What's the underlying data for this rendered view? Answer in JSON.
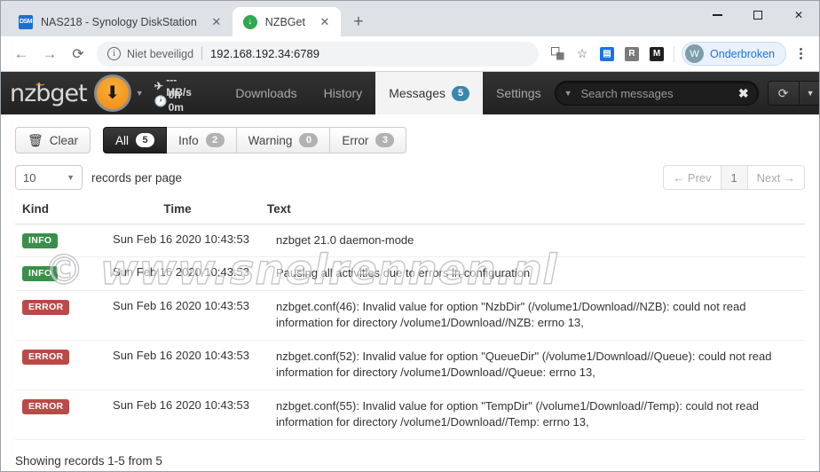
{
  "browser": {
    "tabs": [
      {
        "title": "NAS218 - Synology DiskStation",
        "favicon": "dsm-icon",
        "favicon_text": "DSM",
        "active": false
      },
      {
        "title": "NZBGet",
        "favicon": "nzbget-download-icon",
        "favicon_text": "↓",
        "active": true
      }
    ],
    "new_tab_label": "+",
    "close_label": "✕",
    "window_controls": {
      "minimize": "—",
      "maximize": "□",
      "close": "✕"
    },
    "nav": {
      "back": "←",
      "forward": "→",
      "reload": "⟳"
    },
    "omnibox": {
      "security_label": "Niet beveiligd",
      "info_glyph": "i",
      "url": "192.168.192.34:6789"
    },
    "toolbar_icons": [
      {
        "name": "translate-icon",
        "glyph": "⧉"
      },
      {
        "name": "bookmark-star-icon",
        "glyph": "☆"
      },
      {
        "name": "extension-blue-icon",
        "glyph": "▤",
        "color": "#1a73e8"
      },
      {
        "name": "extension-r-icon",
        "glyph": "R",
        "color": "#7a7a7a"
      },
      {
        "name": "extension-m-icon",
        "glyph": "M",
        "color": "#1f1f1f"
      }
    ],
    "profile": {
      "initial": "W",
      "label": "Onderbroken",
      "accent": "#1a73e8"
    }
  },
  "nzbget": {
    "brand": "nzbget",
    "play_button_glyph": "⬇",
    "caret_glyph": "▼",
    "stats": {
      "speed_icon": "airplane-icon",
      "speed": "--- MB/s",
      "time_icon": "clock-icon",
      "time": "0h 0m"
    },
    "nav_items": [
      {
        "label": "Downloads",
        "active": false,
        "badge": null
      },
      {
        "label": "History",
        "active": false,
        "badge": null
      },
      {
        "label": "Messages",
        "active": true,
        "badge": "5"
      },
      {
        "label": "Settings",
        "active": false,
        "badge": null
      }
    ],
    "search": {
      "placeholder": "Search messages",
      "value": "",
      "dropdown_glyph": "▼",
      "clear_glyph": "✖"
    },
    "refresh": {
      "glyph": "⟳",
      "dropdown_glyph": "▼"
    },
    "badge_accent": "#3a87ad"
  },
  "toolbar": {
    "clear_label": "Clear",
    "trash_glyph": "🗑",
    "filters": [
      {
        "label": "All",
        "count": "5",
        "active": true
      },
      {
        "label": "Info",
        "count": "2",
        "active": false
      },
      {
        "label": "Warning",
        "count": "0",
        "active": false
      },
      {
        "label": "Error",
        "count": "3",
        "active": false
      }
    ]
  },
  "pagination": {
    "records_per_page_value": "10",
    "records_per_page_label": "records per page",
    "caret_glyph": "▼",
    "prev_label": "← Prev",
    "page_label": "1",
    "next_label": "Next →"
  },
  "table": {
    "columns": [
      "Kind",
      "Time",
      "Text"
    ],
    "rows": [
      {
        "kind": "INFO",
        "kind_class": "info",
        "time": "Sun Feb 16 2020 10:43:53",
        "text": "nzbget 21.0 daemon-mode"
      },
      {
        "kind": "INFO",
        "kind_class": "info",
        "time": "Sun Feb 16 2020 10:43:53",
        "text": "Pausing all activities due to errors in configuration"
      },
      {
        "kind": "ERROR",
        "kind_class": "error",
        "time": "Sun Feb 16 2020 10:43:53",
        "text": "nzbget.conf(46): Invalid value for option \"NzbDir\" (/volume1/Download//NZB): could not read information for directory /volume1/Download//NZB: errno 13,"
      },
      {
        "kind": "ERROR",
        "kind_class": "error",
        "time": "Sun Feb 16 2020 10:43:53",
        "text": "nzbget.conf(52): Invalid value for option \"QueueDir\" (/volume1/Download//Queue): could not read information for directory /volume1/Download//Queue: errno 13,"
      },
      {
        "kind": "ERROR",
        "kind_class": "error",
        "time": "Sun Feb 16 2020 10:43:53",
        "text": "nzbget.conf(55): Invalid value for option \"TempDir\" (/volume1/Download//Temp): could not read information for directory /volume1/Download//Temp: errno 13,"
      }
    ],
    "footer": "Showing records 1-5 from 5"
  },
  "watermark": {
    "text": "© www.snelrennen.nl"
  },
  "colors": {
    "info_badge": "#3a8f4a",
    "error_badge": "#b94a48",
    "nav_badge": "#3a87ad",
    "brand_orange": "#ef8a12"
  }
}
